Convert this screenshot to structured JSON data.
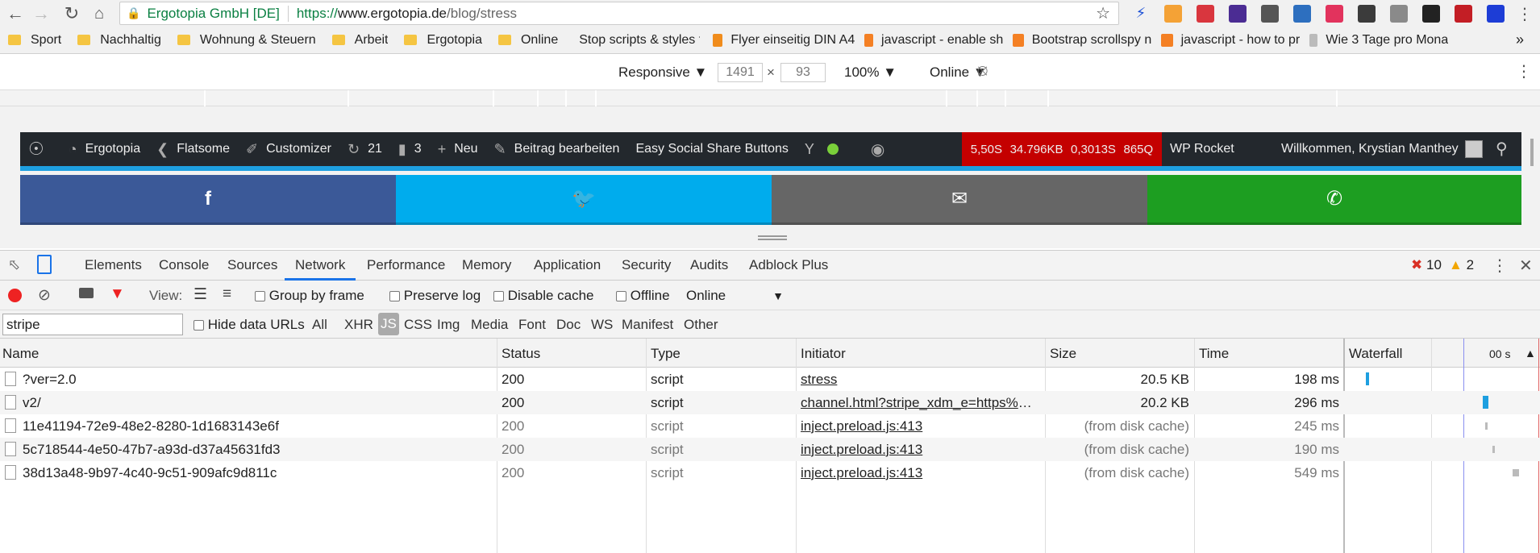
{
  "browser": {
    "site_name": "Ergotopia GmbH [DE]",
    "url_scheme": "https://",
    "url_host": "www.ergotopia.de",
    "url_path": "/blog/stress"
  },
  "bookmarks": [
    {
      "label": "Sport",
      "icon": "folder-icon"
    },
    {
      "label": "Nachhaltig",
      "icon": "folder-icon"
    },
    {
      "label": "Wohnung & Steuern",
      "icon": "folder-icon"
    },
    {
      "label": "Arbeit",
      "icon": "folder-icon"
    },
    {
      "label": "Ergotopia",
      "icon": "folder-icon"
    },
    {
      "label": "Online",
      "icon": "folder-icon"
    },
    {
      "label": "Stop scripts & styles f",
      "icon": "github-icon"
    },
    {
      "label": "Flyer einseitig DIN A4",
      "icon": "grid-icon"
    },
    {
      "label": "javascript - enable sh",
      "icon": "stackoverflow-icon"
    },
    {
      "label": "Bootstrap scrollspy n",
      "icon": "stackoverflow-icon"
    },
    {
      "label": "javascript - how to pr",
      "icon": "stackoverflow-icon"
    },
    {
      "label": "Wie 3 Tage pro Mona",
      "icon": "grid-icon"
    }
  ],
  "bookmarks_more": "»",
  "device_toolbar": {
    "mode": "Responsive",
    "width": "1491",
    "times": "×",
    "height": "93",
    "zoom": "100%",
    "network": "Online"
  },
  "wp_admin_bar": {
    "site": "Ergotopia",
    "theme": "Flatsome",
    "customizer": "Customizer",
    "updates": "21",
    "comments": "3",
    "new": "Neu",
    "edit": "Beitrag bearbeiten",
    "share_plugin": "Easy Social Share Buttons",
    "perf": [
      "5,50S",
      "34.796KB",
      "0,3013S",
      "865Q"
    ],
    "rocket": "WP Rocket",
    "welcome": "Willkommen, Krystian Manthey"
  },
  "share_buttons": [
    {
      "name": "facebook",
      "glyph": "f",
      "color": "#3b5998"
    },
    {
      "name": "twitter",
      "glyph": "t",
      "color": "#00aced"
    },
    {
      "name": "email",
      "glyph": "✉",
      "color": "#666666"
    },
    {
      "name": "whatsapp",
      "glyph": "✆",
      "color": "#1d9e21"
    }
  ],
  "devtools": {
    "tabs": [
      "Elements",
      "Console",
      "Sources",
      "Network",
      "Performance",
      "Memory",
      "Application",
      "Security",
      "Audits",
      "Adblock Plus"
    ],
    "active_tab": "Network",
    "errors": "10",
    "warnings": "2",
    "controls": {
      "view_label": "View:",
      "group_by_frame": "Group by frame",
      "preserve_log": "Preserve log",
      "disable_cache": "Disable cache",
      "offline": "Offline",
      "throttle": "Online"
    },
    "filter": {
      "value": "stripe",
      "hide_data_urls": "Hide data URLs",
      "types": [
        "All",
        "XHR",
        "JS",
        "CSS",
        "Img",
        "Media",
        "Font",
        "Doc",
        "WS",
        "Manifest",
        "Other"
      ],
      "active_type": "JS"
    },
    "columns": [
      "Name",
      "Status",
      "Type",
      "Initiator",
      "Size",
      "Time",
      "Waterfall"
    ],
    "waterfall_scale": "00 s",
    "rows": [
      {
        "name": "?ver=2.0",
        "status": "200",
        "type": "script",
        "initiator": "stress",
        "size": "20.5 KB",
        "time": "198 ms",
        "cached": false
      },
      {
        "name": "v2/",
        "status": "200",
        "type": "script",
        "initiator": "channel.html?stripe_xdm_e=https%3A...",
        "size": "20.2 KB",
        "time": "296 ms",
        "cached": false
      },
      {
        "name": "11e41194-72e9-48e2-8280-1d1683143e6f",
        "status": "200",
        "type": "script",
        "initiator": "inject.preload.js:413",
        "size": "(from disk cache)",
        "time": "245 ms",
        "cached": true
      },
      {
        "name": "5c718544-4e50-47b7-a93d-d37a45631fd3",
        "status": "200",
        "type": "script",
        "initiator": "inject.preload.js:413",
        "size": "(from disk cache)",
        "time": "190 ms",
        "cached": true
      },
      {
        "name": "38d13a48-9b97-4c40-9c51-909afc9d811c",
        "status": "200",
        "type": "script",
        "initiator": "inject.preload.js:413",
        "size": "(from disk cache)",
        "time": "549 ms",
        "cached": true
      }
    ]
  }
}
